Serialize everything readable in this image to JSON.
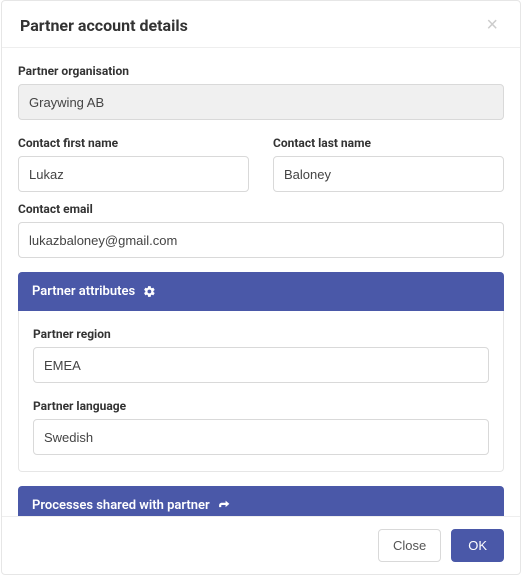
{
  "header": {
    "title": "Partner account details"
  },
  "fields": {
    "org_label": "Partner organisation",
    "org_value": "Graywing AB",
    "first_label": "Contact first name",
    "first_value": "Lukaz",
    "last_label": "Contact last name",
    "last_value": "Baloney",
    "email_label": "Contact email",
    "email_value": "lukazbaloney@gmail.com"
  },
  "attributes": {
    "band_title": "Partner attributes",
    "region_label": "Partner region",
    "region_value": "EMEA",
    "language_label": "Partner language",
    "language_value": "Swedish"
  },
  "processes": {
    "band_title": "Processes shared with partner"
  },
  "footer": {
    "close_label": "Close",
    "ok_label": "OK"
  }
}
